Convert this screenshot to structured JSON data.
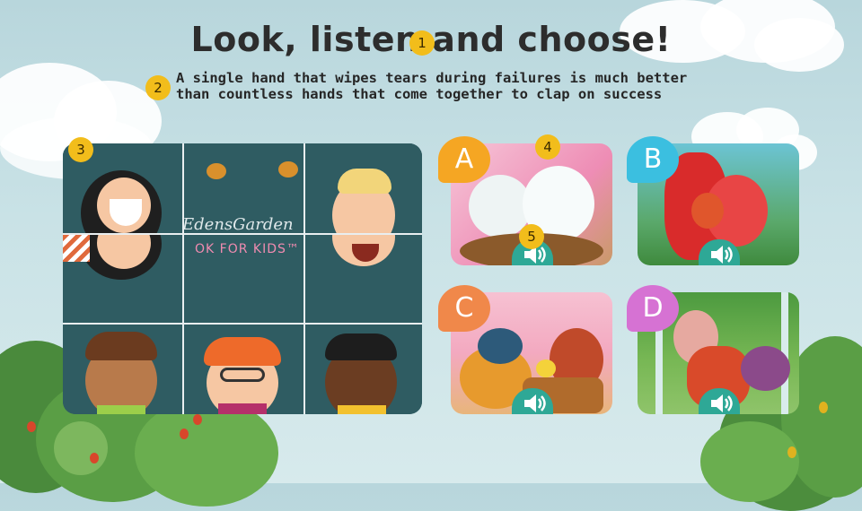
{
  "title": "Look, listen and choose!",
  "subtitle": {
    "line1": "A single hand that wipes tears during failures is much better",
    "line2": "than countless hands that come together to clap on success"
  },
  "markers": [
    "1",
    "2",
    "3",
    "4",
    "5"
  ],
  "puzzle": {
    "logo_line1": "EdensGarden",
    "logo_line2": "OK FOR KIDS™"
  },
  "options": [
    {
      "letter": "A",
      "color": "#f5a623",
      "scene": "white hens with chicks"
    },
    {
      "letter": "B",
      "color": "#3bbfe0",
      "scene": "red squirrels"
    },
    {
      "letter": "C",
      "color": "#f0884a",
      "scene": "rooster and hen with chicks"
    },
    {
      "letter": "D",
      "color": "#d672d3",
      "scene": "goats in forest"
    }
  ],
  "icons": {
    "sound": "speaker-icon"
  },
  "colors": {
    "marker": "#f2bd1b",
    "sound_button": "#2ea896",
    "puzzle_bg": "#2e5a60"
  }
}
